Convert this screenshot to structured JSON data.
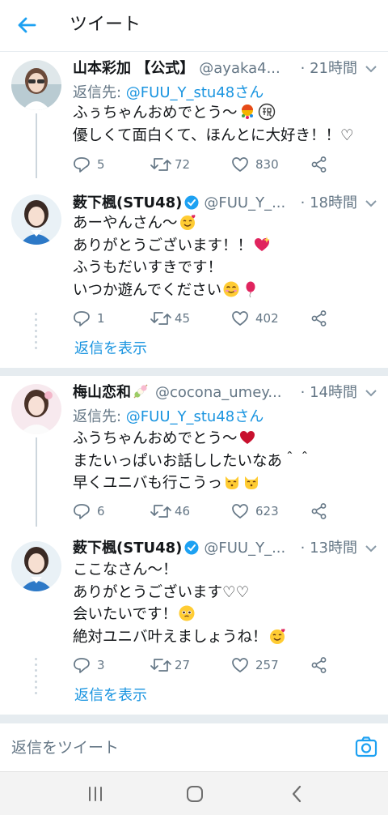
{
  "header": {
    "title": "ツイート"
  },
  "tweets": [
    {
      "name": "山本彩加 【公式】",
      "handle": "@ayaka4...",
      "time": "· 21時間",
      "reply_to_prefix": "返信先: ",
      "reply_to_user": "@FUU_Y_stu48さん",
      "lines": [
        "ふぅちゃんおめでとう〜",
        "優しくて面白くて、ほんとに大好き！！♡"
      ],
      "replies": "5",
      "retweets": "72",
      "likes": "830"
    },
    {
      "name": "薮下楓(STU48)",
      "handle": "@FUU_Y_...",
      "time": "· 18時間",
      "lines": [
        "あーやんさん〜",
        "ありがとうございます！！",
        "ふうもだいすきです！",
        "いつか遊んでください"
      ],
      "replies": "1",
      "retweets": "45",
      "likes": "402",
      "show_replies": "返信を表示"
    },
    {
      "name": "梅山恋和",
      "handle": "@cocona_umey...",
      "time": "· 14時間",
      "reply_to_prefix": "返信先: ",
      "reply_to_user": "@FUU_Y_stu48さん",
      "lines": [
        "ふうちゃんおめでとう〜",
        "またいっぱいお話ししたいなあ＾＾",
        "早くユニバも行こうっ"
      ],
      "replies": "6",
      "retweets": "46",
      "likes": "623"
    },
    {
      "name": "薮下楓(STU48)",
      "handle": "@FUU_Y_...",
      "time": "· 13時間",
      "lines": [
        "ここなさん〜！",
        "ありがとうございます♡♡",
        "会いたいです！",
        "絶対ユニバ叶えましょうね！"
      ],
      "replies": "3",
      "retweets": "27",
      "likes": "257",
      "show_replies": "返信を表示"
    }
  ],
  "reply_bar": {
    "placeholder": "返信をツイート"
  },
  "colors": {
    "accent": "#1da1f2",
    "link": "#1b95e0",
    "muted": "#657786",
    "verified": "#1da1f2"
  }
}
